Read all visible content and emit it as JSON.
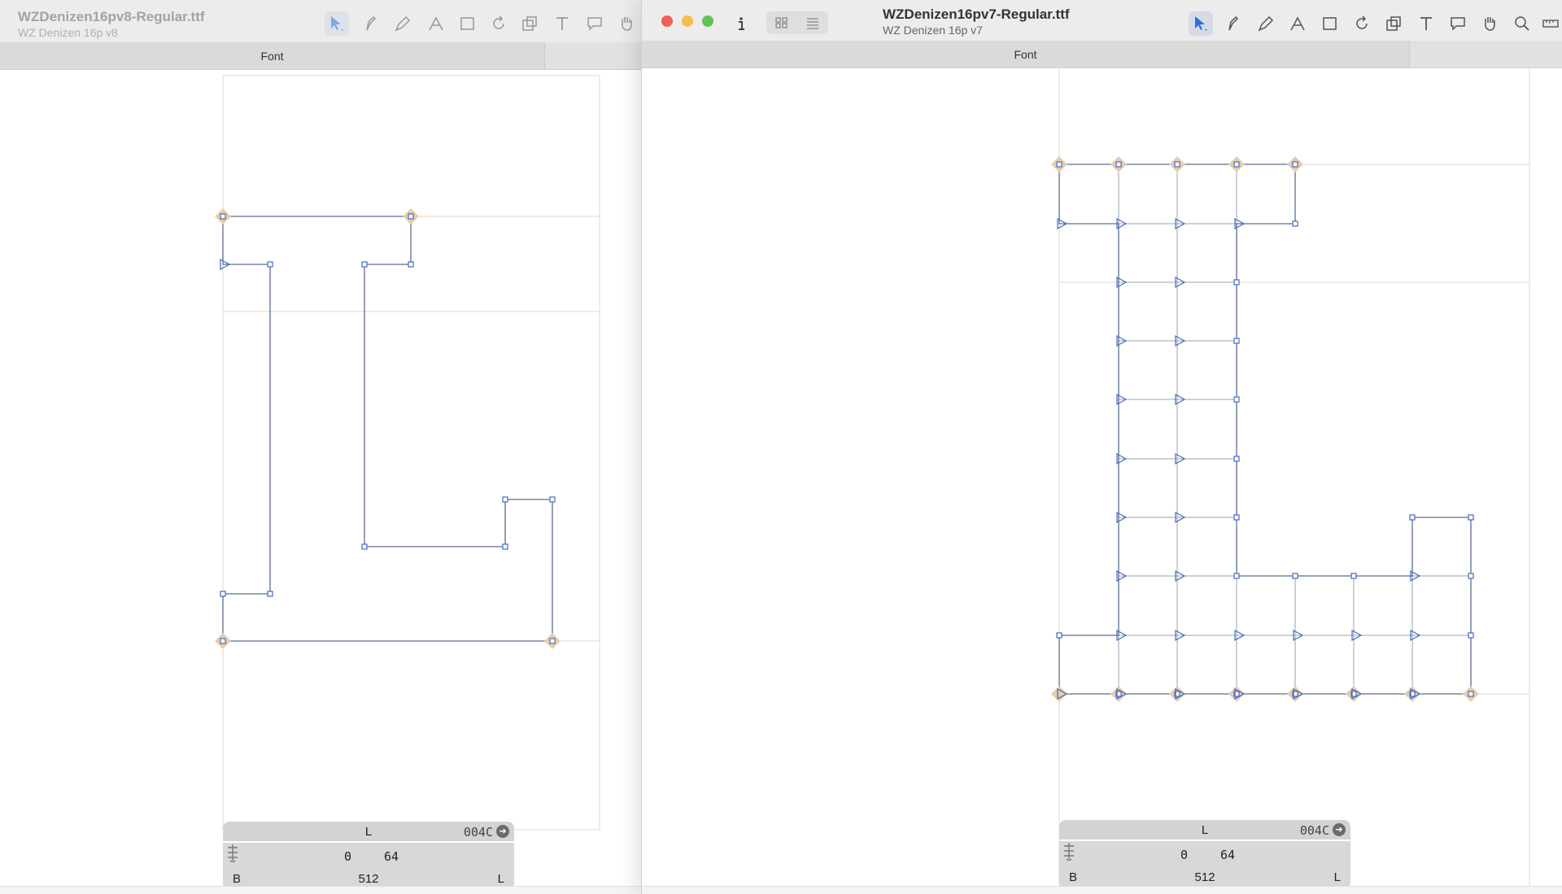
{
  "back_window": {
    "title": "WZDenizen16pv8-Regular.ttf",
    "subtitle": "WZ Denizen 16p v8",
    "tab_label": "Font",
    "glyph": {
      "name": "L",
      "code": "004C",
      "lsb": "0",
      "rsb": "64",
      "width": "512",
      "left_class": "B",
      "right_class": "L"
    }
  },
  "front_window": {
    "title": "WZDenizen16pv7-Regular.ttf",
    "subtitle": "WZ Denizen 16p v7",
    "tab_label": "Font",
    "glyph": {
      "name": "L",
      "code": "004C",
      "lsb": "0",
      "rsb": "64",
      "width": "512",
      "left_class": "B",
      "right_class": "L"
    }
  },
  "toolbar": {
    "tools": [
      "select-tool",
      "knife-tool",
      "pen-tool",
      "draw-tool",
      "rectangle-tool",
      "rotate-tool",
      "scale-tool",
      "text-tool",
      "annotation-tool",
      "hand-tool",
      "zoom-tool",
      "measure-tool"
    ],
    "info_icon": "info-icon",
    "view_modes": [
      "grid-view-icon",
      "list-view-icon"
    ]
  },
  "colors": {
    "outline": "#5a6d8c",
    "node": "#3f6cc4",
    "extreme_marker": "#e9ccab",
    "metrics_line": "#e8d6c4",
    "selected_tool_bg": "#d4dbe6",
    "traffic_close": "#ee5f57",
    "traffic_minimize": "#f5bd4f",
    "traffic_zoom": "#61c454"
  }
}
